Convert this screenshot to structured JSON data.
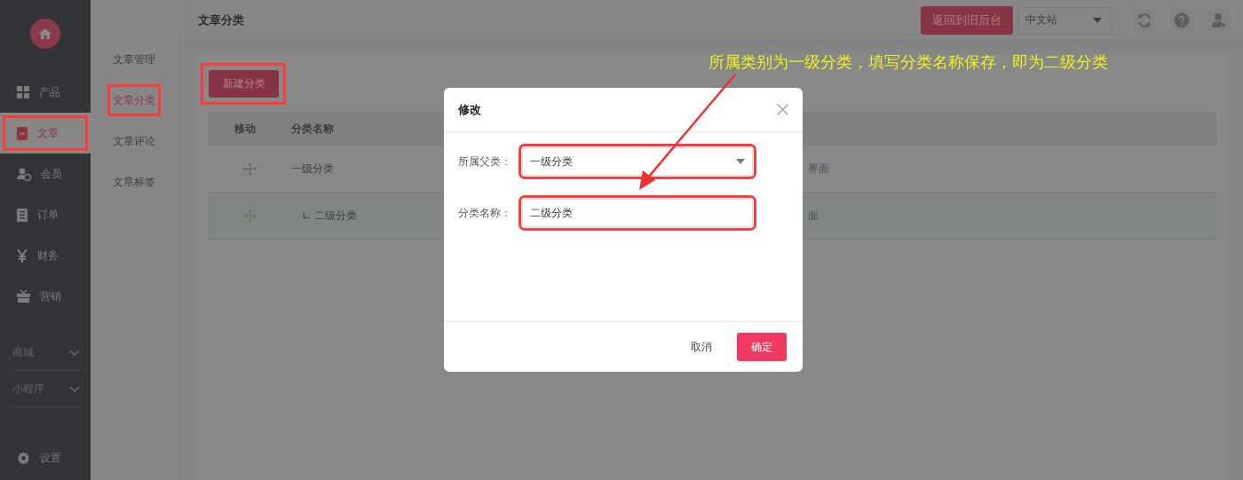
{
  "sidebar": {
    "items": [
      {
        "label": "产品",
        "selected": false,
        "highlighted": false
      },
      {
        "label": "文章",
        "selected": true,
        "highlighted": true
      },
      {
        "label": "会员",
        "selected": false,
        "highlighted": false
      },
      {
        "label": "订单",
        "selected": false,
        "highlighted": false
      },
      {
        "label": "财务",
        "selected": false,
        "highlighted": false
      },
      {
        "label": "营销",
        "selected": false,
        "highlighted": false
      }
    ],
    "groups": [
      {
        "label": "商城"
      },
      {
        "label": "小程序"
      }
    ],
    "settings": "设置"
  },
  "submenu": [
    {
      "label": "文章管理",
      "selected": false,
      "highlighted": false
    },
    {
      "label": "文章分类",
      "selected": true,
      "highlighted": true
    },
    {
      "label": "文章评论",
      "selected": false,
      "highlighted": false
    },
    {
      "label": "文章标签",
      "selected": false,
      "highlighted": false
    }
  ],
  "header": {
    "title": "文章分类",
    "back_button": "返回到旧后台",
    "site_select": "中文站"
  },
  "new_button": {
    "label": "新建分类",
    "highlighted": true
  },
  "table": {
    "columns": [
      "移动",
      "分类名称"
    ],
    "rows": [
      {
        "name": "一级分类",
        "column_3": "界面",
        "selected": false,
        "children": [
          {
            "name": "∟ 二级分类",
            "column_3": "面",
            "selected": true
          }
        ]
      }
    ]
  },
  "dialog": {
    "title": "修改",
    "fields": [
      {
        "kind": "select",
        "label": "所属父类：",
        "value": "一级分类",
        "highlighted": true
      },
      {
        "kind": "input",
        "label": "分类名称：",
        "value": "二级分类",
        "highlighted": true
      }
    ],
    "cancel": "取消",
    "ok": "确定"
  },
  "annotation": {
    "text": "所属类别为一级分类，填写分类名称保存，即为二级分类"
  }
}
